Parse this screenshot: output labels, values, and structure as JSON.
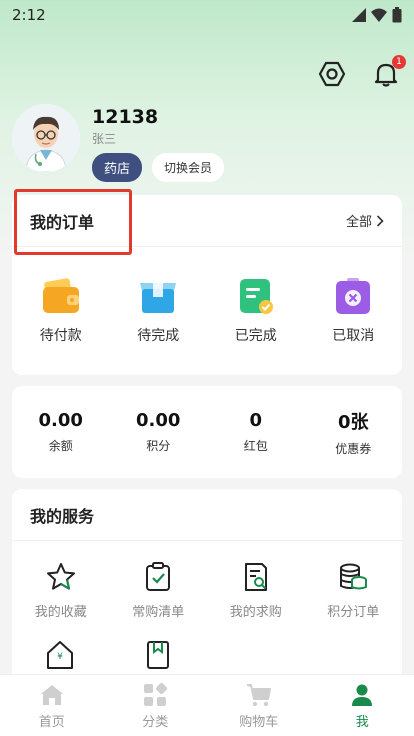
{
  "status_bar": {
    "time": "2:12"
  },
  "header": {
    "notification_count": "1"
  },
  "profile": {
    "user_id": "12138",
    "name": "张三",
    "tag_store": "药店",
    "tag_switch": "切换会员"
  },
  "orders": {
    "title": "我的订单",
    "see_all": "全部",
    "items": [
      {
        "label": "待付款",
        "icon": "wallet-icon"
      },
      {
        "label": "待完成",
        "icon": "package-icon"
      },
      {
        "label": "已完成",
        "icon": "completed-icon"
      },
      {
        "label": "已取消",
        "icon": "cancel-icon"
      }
    ]
  },
  "stats": [
    {
      "value": "0.00",
      "label": "余额"
    },
    {
      "value": "0.00",
      "label": "积分"
    },
    {
      "value": "0",
      "label": "红包"
    },
    {
      "value": "0张",
      "label": "优惠券"
    }
  ],
  "services": {
    "title": "我的服务",
    "items": [
      {
        "label": "我的收藏",
        "icon": "star-icon"
      },
      {
        "label": "常购清单",
        "icon": "checklist-icon"
      },
      {
        "label": "我的求购",
        "icon": "search-doc-icon"
      },
      {
        "label": "积分订单",
        "icon": "coins-icon"
      }
    ]
  },
  "tabs": [
    {
      "label": "首页",
      "icon": "home-icon"
    },
    {
      "label": "分类",
      "icon": "category-icon"
    },
    {
      "label": "购物车",
      "icon": "cart-icon"
    },
    {
      "label": "我",
      "icon": "user-icon"
    }
  ],
  "colors": {
    "accent": "#1a8a4c",
    "highlight": "#e03a2c",
    "store_tag": "#3f4f7f"
  }
}
